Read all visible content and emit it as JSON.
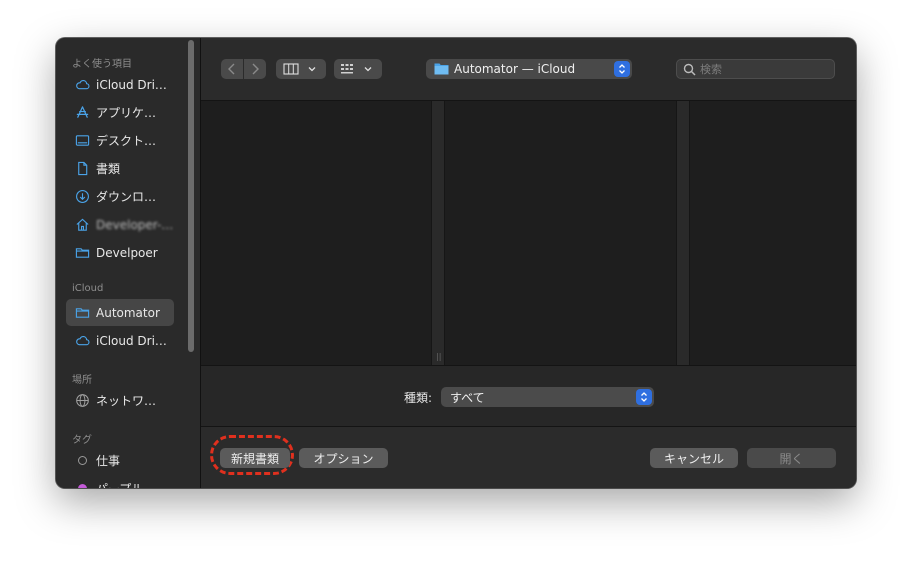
{
  "sidebar": {
    "favorites_header": "よく使う項目",
    "favorites": [
      {
        "label": "iCloud Dri…",
        "icon": "cloud-icon"
      },
      {
        "label": "アプリケ…",
        "icon": "applications-icon"
      },
      {
        "label": "デスクト…",
        "icon": "desktop-icon"
      },
      {
        "label": "書類",
        "icon": "document-icon"
      },
      {
        "label": "ダウンロ…",
        "icon": "download-icon"
      },
      {
        "label": "Developer-home",
        "icon": "home-icon"
      },
      {
        "label": "Develpoer",
        "icon": "folder-icon"
      }
    ],
    "icloud_header": "iCloud",
    "icloud": [
      {
        "label": "Automator",
        "icon": "folder-icon",
        "selected": true
      },
      {
        "label": "iCloud Dri…",
        "icon": "cloud-icon"
      }
    ],
    "locations_header": "場所",
    "locations": [
      {
        "label": "ネットワ…",
        "icon": "network-icon"
      }
    ],
    "tags_header": "タグ",
    "tags": [
      {
        "label": "仕事",
        "color": "#9a9a9a"
      },
      {
        "label": "パープル",
        "color": "#c45ad8"
      }
    ]
  },
  "toolbar": {
    "location_title": "Automator — iCloud",
    "search_placeholder": "検索"
  },
  "format": {
    "label": "種類:",
    "value": "すべて"
  },
  "buttons": {
    "new_document": "新規書類",
    "options": "オプション",
    "cancel": "キャンセル",
    "open": "開く"
  },
  "colors": {
    "accent_blue": "#2f6fe0",
    "highlight_red": "#e0301e",
    "folder_blue": "#4aa3e8"
  }
}
